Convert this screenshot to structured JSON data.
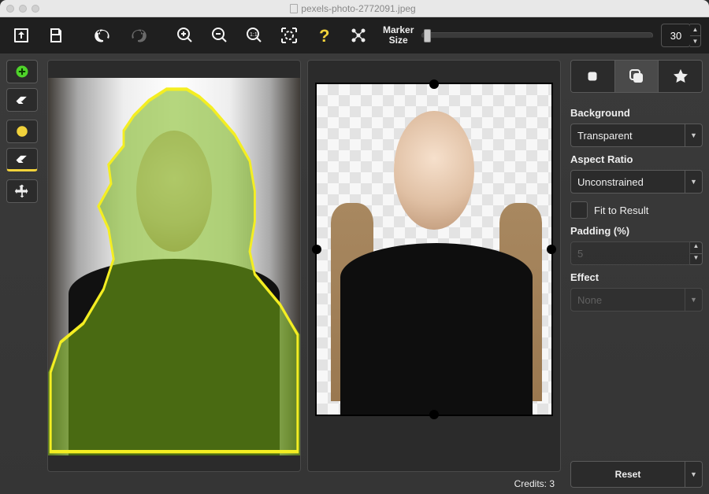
{
  "window": {
    "title": "pexels-photo-2772091.jpeg"
  },
  "toolbar": {
    "marker_label_line1": "Marker",
    "marker_label_line2": "Size",
    "marker_size": "30"
  },
  "inspector": {
    "tabs_active_index": 1,
    "background_label": "Background",
    "background_value": "Transparent",
    "aspect_label": "Aspect Ratio",
    "aspect_value": "Unconstrained",
    "fit_label": "Fit to Result",
    "fit_checked": false,
    "padding_label": "Padding (%)",
    "padding_value": "5",
    "effect_label": "Effect",
    "effect_value": "None",
    "reset_label": "Reset"
  },
  "footer": {
    "credits_text": "Credits: 3"
  }
}
